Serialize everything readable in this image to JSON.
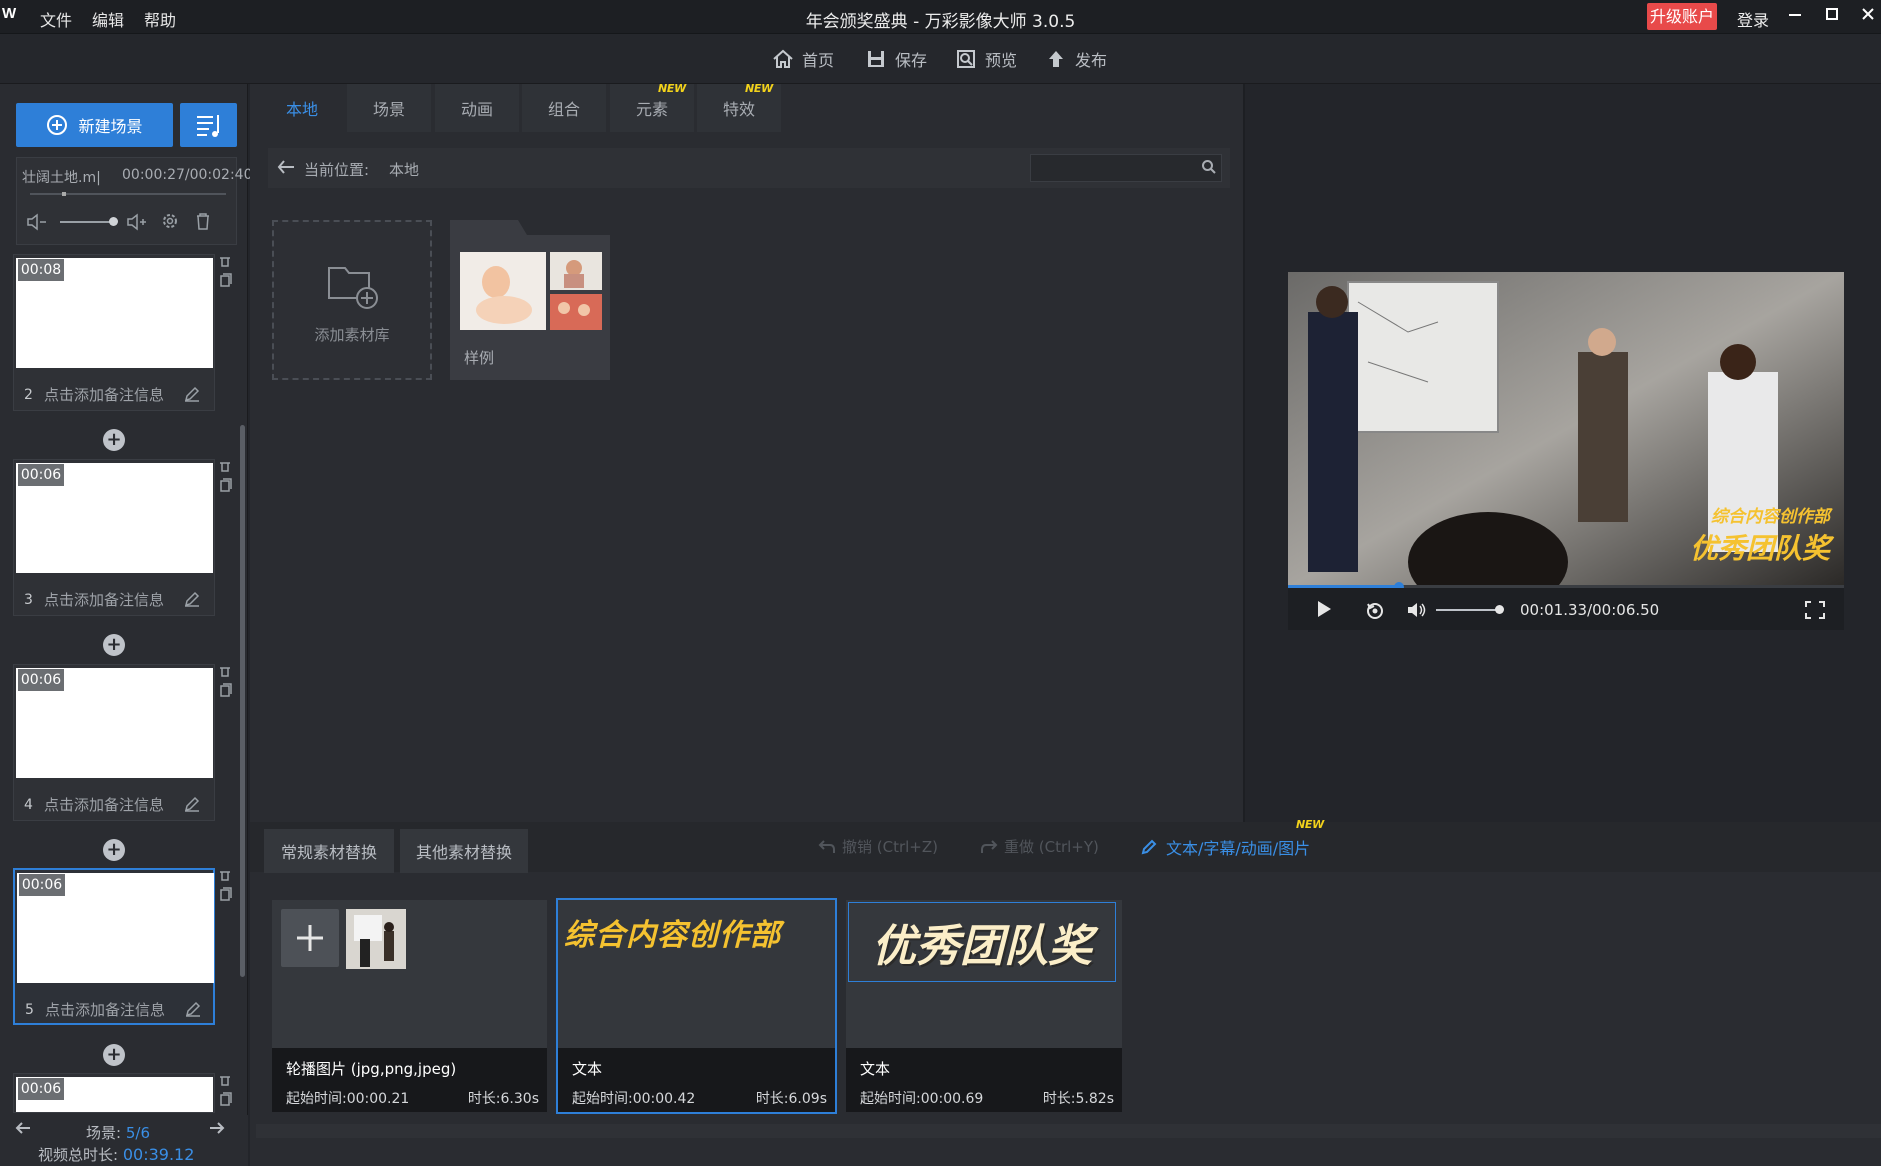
{
  "titlebar": {
    "logo": "W",
    "menus": [
      "文件",
      "编辑",
      "帮助"
    ],
    "title": "年会颁奖盛典 - 万彩影像大师 3.0.5",
    "upgrade": "升级账户",
    "login": "登录"
  },
  "toolbar": {
    "items": [
      {
        "label": "首页",
        "icon": "home-icon"
      },
      {
        "label": "保存",
        "icon": "save-icon"
      },
      {
        "label": "预览",
        "icon": "preview-icon"
      },
      {
        "label": "发布",
        "icon": "publish-icon"
      }
    ]
  },
  "left": {
    "new_scene": "新建场景",
    "audio": {
      "name": "壮阔土地.m|",
      "time": "00:00:27/00:02:40"
    },
    "scenes": [
      {
        "num": "2",
        "dur": "00:08",
        "note": "点击添加备注信息"
      },
      {
        "num": "3",
        "dur": "00:06",
        "note": "点击添加备注信息"
      },
      {
        "num": "4",
        "dur": "00:06",
        "note": "点击添加备注信息"
      },
      {
        "num": "5",
        "dur": "00:06",
        "note": "点击添加备注信息"
      },
      {
        "num": "",
        "dur": "00:06",
        "note": ""
      }
    ],
    "footer": {
      "scene_label": "场景:",
      "scene_value": "5/6",
      "total_label": "视频总时长:",
      "total_value": "00:39.12"
    }
  },
  "tabs": [
    {
      "label": "本地",
      "new": false
    },
    {
      "label": "场景",
      "new": false
    },
    {
      "label": "动画",
      "new": false
    },
    {
      "label": "组合",
      "new": false
    },
    {
      "label": "元素",
      "new": true
    },
    {
      "label": "特效",
      "new": true
    }
  ],
  "new_badge": "NEW",
  "path": {
    "label": "当前位置:",
    "value": "本地"
  },
  "library": {
    "add_label": "添加素材库",
    "sample_label": "样例"
  },
  "preview": {
    "time": "00:01.33/00:06.50",
    "progress": 0.2,
    "volume": 1.0,
    "caption_small": "综合内容创作部",
    "caption_big": "优秀团队奖"
  },
  "bottom": {
    "tabs": [
      "常规素材替换",
      "其他素材替换"
    ],
    "undo": "撤销 (Ctrl+Z)",
    "redo": "重做 (Ctrl+Y)",
    "edit_link": "文本/字幕/动画/图片",
    "cards": [
      {
        "type": "轮播图片 (jpg,png,jpeg)",
        "start": "起始时间:00:00.21",
        "dur": "时长:6.30s",
        "preview": ""
      },
      {
        "type": "文本",
        "start": "起始时间:00:00.42",
        "dur": "时长:6.09s",
        "preview": "综合内容创作部"
      },
      {
        "type": "文本",
        "start": "起始时间:00:00.69",
        "dur": "时长:5.82s",
        "preview": "优秀团队奖"
      }
    ]
  },
  "colors": {
    "accent": "#2e7fd8",
    "upgrade": "#e84a4a",
    "caption_yellow": "#f5c230",
    "new_badge": "#f2d21b"
  }
}
